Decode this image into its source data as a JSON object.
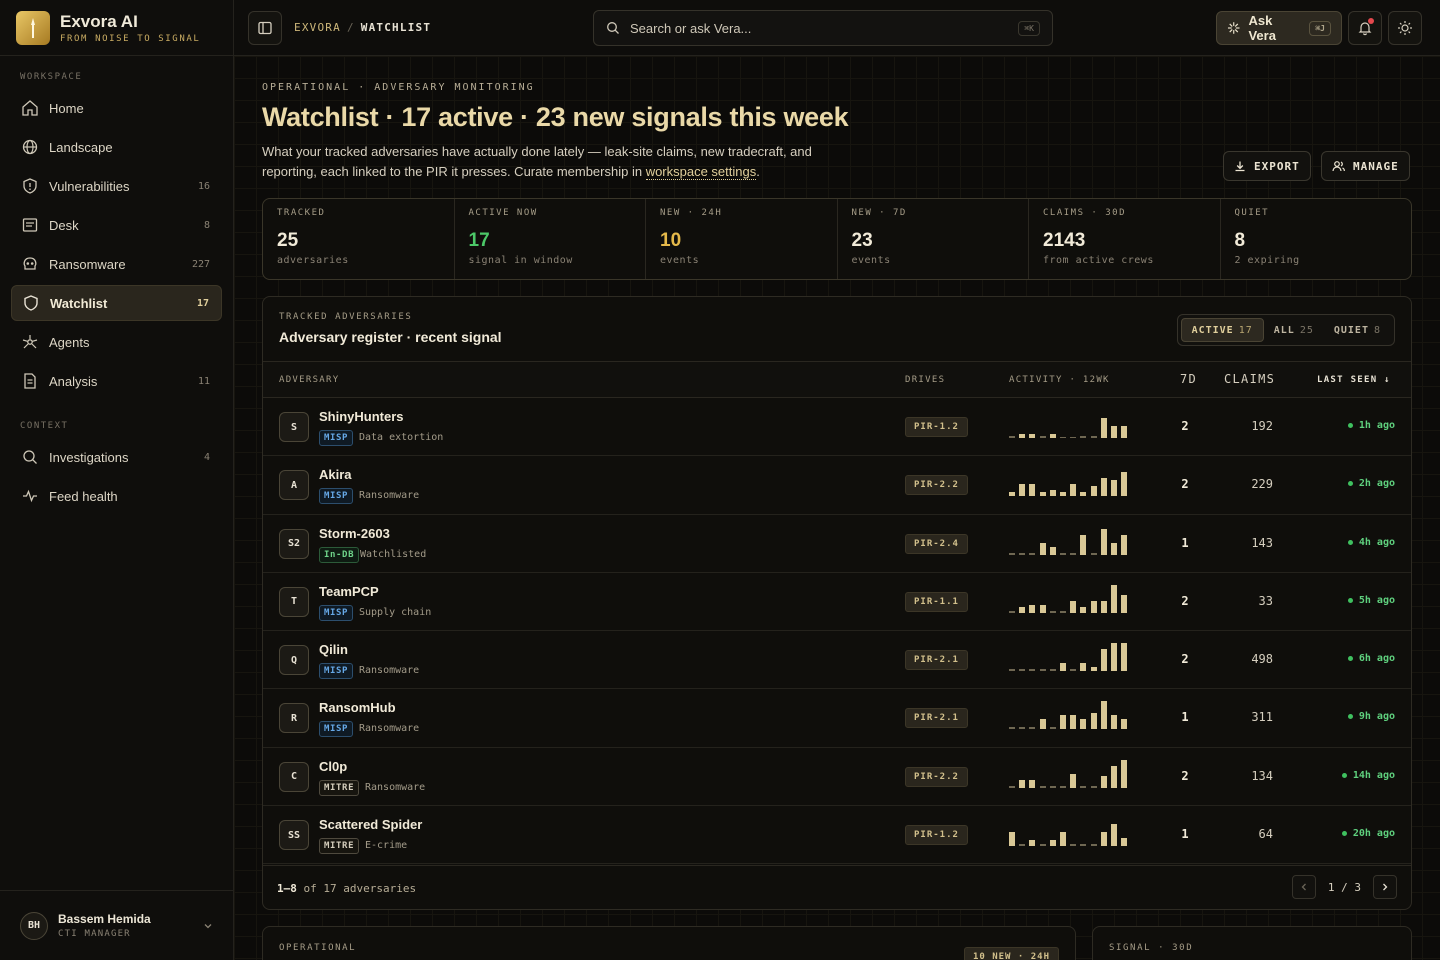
{
  "brand": {
    "name": "Exvora AI",
    "tagline": "FROM NOISE TO SIGNAL"
  },
  "sidebar": {
    "sections": [
      {
        "label": "WORKSPACE",
        "items": [
          {
            "label": "Home",
            "icon": "home-icon",
            "count": ""
          },
          {
            "label": "Landscape",
            "icon": "globe-icon",
            "count": ""
          },
          {
            "label": "Vulnerabilities",
            "icon": "shield-alert-icon",
            "count": "16"
          },
          {
            "label": "Desk",
            "icon": "desk-icon",
            "count": "8"
          },
          {
            "label": "Ransomware",
            "icon": "skull-icon",
            "count": "227"
          },
          {
            "label": "Watchlist",
            "icon": "shield-icon",
            "count": "17",
            "active": true
          },
          {
            "label": "Agents",
            "icon": "agents-icon",
            "count": ""
          },
          {
            "label": "Analysis",
            "icon": "document-icon",
            "count": "11"
          }
        ]
      },
      {
        "label": "CONTEXT",
        "items": [
          {
            "label": "Investigations",
            "icon": "search-icon",
            "count": "4"
          },
          {
            "label": "Feed health",
            "icon": "pulse-icon",
            "count": ""
          }
        ]
      }
    ],
    "user": {
      "initials": "BH",
      "name": "Bassem Hemida",
      "role": "CTI MANAGER"
    }
  },
  "topbar": {
    "breadcrumb": [
      "EXVORA",
      "WATCHLIST"
    ],
    "search_placeholder": "Search or ask Vera...",
    "search_shortcut": "⌘K",
    "ask_label": "Ask Vera",
    "ask_shortcut": "⌘J"
  },
  "header": {
    "eyebrow": "OPERATIONAL · ADVERSARY MONITORING",
    "title": "Watchlist · 17 active · 23 new signals this week",
    "description_pre": "What your tracked adversaries have actually done lately — leak-site claims, new tradecraft, and reporting, each linked to the PIR it presses. Curate membership in ",
    "description_link": "workspace settings",
    "description_post": ".",
    "export_label": "EXPORT",
    "manage_label": "MANAGE"
  },
  "stats": [
    {
      "label": "TRACKED",
      "value": "25",
      "sub": "adversaries",
      "color": "#f1ead8"
    },
    {
      "label": "ACTIVE NOW",
      "value": "17",
      "sub": "signal in window",
      "color": "#4cc868"
    },
    {
      "label": "NEW · 24H",
      "value": "10",
      "sub": "events",
      "color": "#e5b94a"
    },
    {
      "label": "NEW · 7D",
      "value": "23",
      "sub": "events",
      "color": "#f1ead8"
    },
    {
      "label": "CLAIMS · 30D",
      "value": "2143",
      "sub": "from active crews",
      "color": "#f1ead8"
    },
    {
      "label": "QUIET",
      "value": "8",
      "sub": "2 expiring",
      "color": "#f1ead8"
    }
  ],
  "register": {
    "eyebrow": "TRACKED ADVERSARIES",
    "title": "Adversary register · recent signal",
    "filters": [
      {
        "label": "ACTIVE",
        "count": "17",
        "active": true
      },
      {
        "label": "ALL",
        "count": "25"
      },
      {
        "label": "QUIET",
        "count": "8"
      }
    ],
    "columns": {
      "adversary": "ADVERSARY",
      "drives": "DRIVES",
      "activity": "ACTIVITY · 12WK",
      "d7": "7D",
      "claims": "CLAIMS",
      "last_seen": "LAST SEEN ↓"
    },
    "rows": [
      {
        "initials": "S",
        "name": "ShinyHunters",
        "source": "MISP",
        "kind": "Data extortion",
        "pir": "PIR-1.2",
        "activity": [
          1,
          2,
          2,
          1,
          2,
          0,
          0,
          1,
          1,
          10,
          6,
          6
        ],
        "d7": "2",
        "claims": "192",
        "seen": "1h ago"
      },
      {
        "initials": "A",
        "name": "Akira",
        "source": "MISP",
        "kind": "Ransomware",
        "pir": "PIR-2.2",
        "activity": [
          2,
          6,
          6,
          2,
          3,
          2,
          6,
          2,
          5,
          9,
          8,
          12
        ],
        "d7": "2",
        "claims": "229",
        "seen": "2h ago"
      },
      {
        "initials": "S2",
        "name": "Storm-2603",
        "source": "In-DB",
        "kind": "Watchlisted",
        "pir": "PIR-2.4",
        "activity": [
          1,
          1,
          1,
          6,
          4,
          1,
          1,
          10,
          1,
          13,
          6,
          10
        ],
        "d7": "1",
        "claims": "143",
        "seen": "4h ago"
      },
      {
        "initials": "T",
        "name": "TeamPCP",
        "source": "MISP",
        "kind": "Supply chain",
        "pir": "PIR-1.1",
        "activity": [
          1,
          3,
          4,
          4,
          1,
          1,
          6,
          3,
          6,
          6,
          14,
          9
        ],
        "d7": "2",
        "claims": "33",
        "seen": "5h ago"
      },
      {
        "initials": "Q",
        "name": "Qilin",
        "source": "MISP",
        "kind": "Ransomware",
        "pir": "PIR-2.1",
        "activity": [
          1,
          1,
          1,
          1,
          1,
          4,
          1,
          4,
          2,
          11,
          14,
          14
        ],
        "d7": "2",
        "claims": "498",
        "seen": "6h ago"
      },
      {
        "initials": "R",
        "name": "RansomHub",
        "source": "MISP",
        "kind": "Ransomware",
        "pir": "PIR-2.1",
        "activity": [
          1,
          1,
          1,
          5,
          1,
          7,
          7,
          5,
          8,
          14,
          7,
          5
        ],
        "d7": "1",
        "claims": "311",
        "seen": "9h ago"
      },
      {
        "initials": "C",
        "name": "Cl0p",
        "source": "MITRE",
        "kind": "Ransomware",
        "pir": "PIR-2.2",
        "activity": [
          1,
          4,
          4,
          1,
          1,
          1,
          7,
          1,
          1,
          6,
          11,
          14
        ],
        "d7": "2",
        "claims": "134",
        "seen": "14h ago"
      },
      {
        "initials": "SS",
        "name": "Scattered Spider",
        "source": "MITRE",
        "kind": "E-crime",
        "pir": "PIR-1.2",
        "activity": [
          7,
          1,
          3,
          1,
          3,
          7,
          1,
          1,
          1,
          7,
          11,
          4
        ],
        "d7": "1",
        "claims": "64",
        "seen": "20h ago"
      }
    ],
    "footer": {
      "range": "1–8",
      "suffix": " of 17 adversaries",
      "page": "1 / 3"
    }
  },
  "bottom": {
    "left_eyebrow": "OPERATIONAL",
    "left_pill": "10 NEW · 24H",
    "right_eyebrow": "SIGNAL · 30D"
  },
  "colors": {
    "accent": "#e0cf9c",
    "active": "#4cc868",
    "warn": "#e5b94a",
    "misp": "#66a8e6"
  }
}
